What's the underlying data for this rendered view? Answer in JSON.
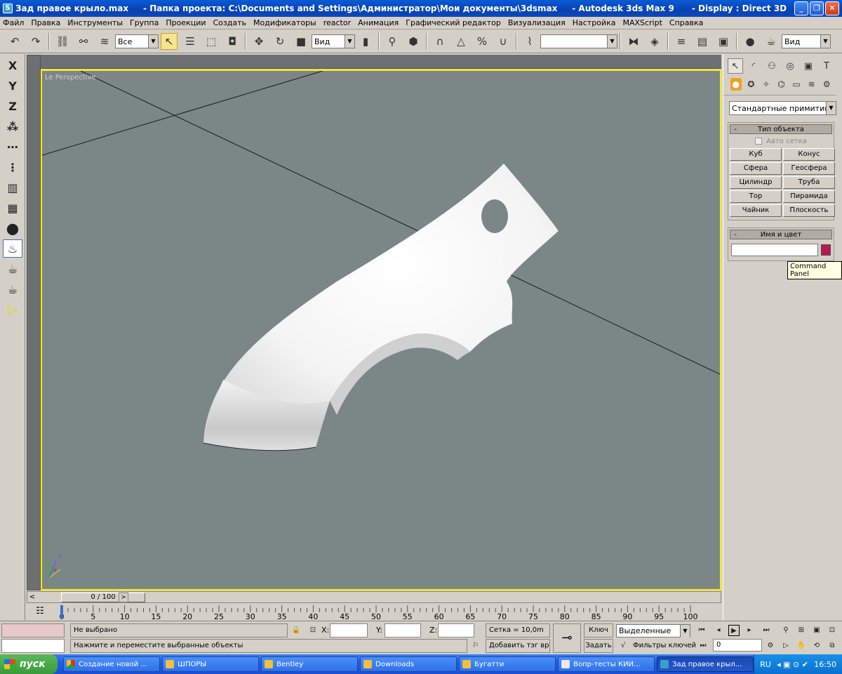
{
  "window": {
    "title": "Зад правое крыло.max     - Папка проекта: C:\\Documents and Settings\\Администратор\\Мои документы\\3dsmax     - Autodesk 3ds Max 9      - Display : Direct 3D",
    "app_icon": "S"
  },
  "menu": [
    "Файл",
    "Правка",
    "Инструменты",
    "Группа",
    "Проекции",
    "Создать",
    "Модификаторы",
    "reactor",
    "Анимация",
    "Графический редактор",
    "Визуализация",
    "Настройка",
    "MAXScript",
    "Справка"
  ],
  "toolbar": {
    "selection_filter": "Все",
    "reference_coord": "Вид",
    "named_selection": "",
    "render_view": "Вид"
  },
  "left_toolbar": [
    "X",
    "Y",
    "Z"
  ],
  "viewport": {
    "label": "Le  Perspective",
    "axis_x": "x",
    "axis_y": "y",
    "axis_z": "z"
  },
  "command_panel": {
    "category": "Стандартные примитивы",
    "object_type_title": "Тип объекта",
    "autogrid": "Авто сетка",
    "buttons": [
      "Куб",
      "Конус",
      "Сфера",
      "Геосфера",
      "Цилиндр",
      "Труба",
      "Тор",
      "Пирамида",
      "Чайник",
      "Плоскость"
    ],
    "name_color_title": "Имя и цвет",
    "name_value": "",
    "object_color": "#b8185a",
    "tooltip": "Command Panel"
  },
  "timeline": {
    "frame_display": "0 / 100",
    "ticks": [
      "0",
      "5",
      "10",
      "15",
      "20",
      "25",
      "30",
      "35",
      "40",
      "45",
      "50",
      "55",
      "60",
      "65",
      "70",
      "75",
      "80",
      "85",
      "90",
      "95",
      "100"
    ]
  },
  "status": {
    "selection": "Не выбрано",
    "prompt": "Нажмите и переместите выбранные объекты",
    "x_label": "X:",
    "y_label": "Y:",
    "z_label": "Z:",
    "x_value": "",
    "y_value": "",
    "z_value": "",
    "grid": "Сетка = 10,0m",
    "add_time_tag": "Добавить тэг врем",
    "key_label": "Ключ",
    "set_key_label": "Задать",
    "key_mode": "Выделенные",
    "key_filters": "Фильтры ключей",
    "current_frame": "0"
  },
  "taskbar": {
    "start": "пуск",
    "tasks": [
      "Создание новой ...",
      "ШПОРЫ",
      "Bentley",
      "Downloads",
      "Бугатти",
      "Вопр-тесты КИИ...",
      "Зад правое крыл..."
    ],
    "lang": "RU",
    "time": "16:50"
  }
}
